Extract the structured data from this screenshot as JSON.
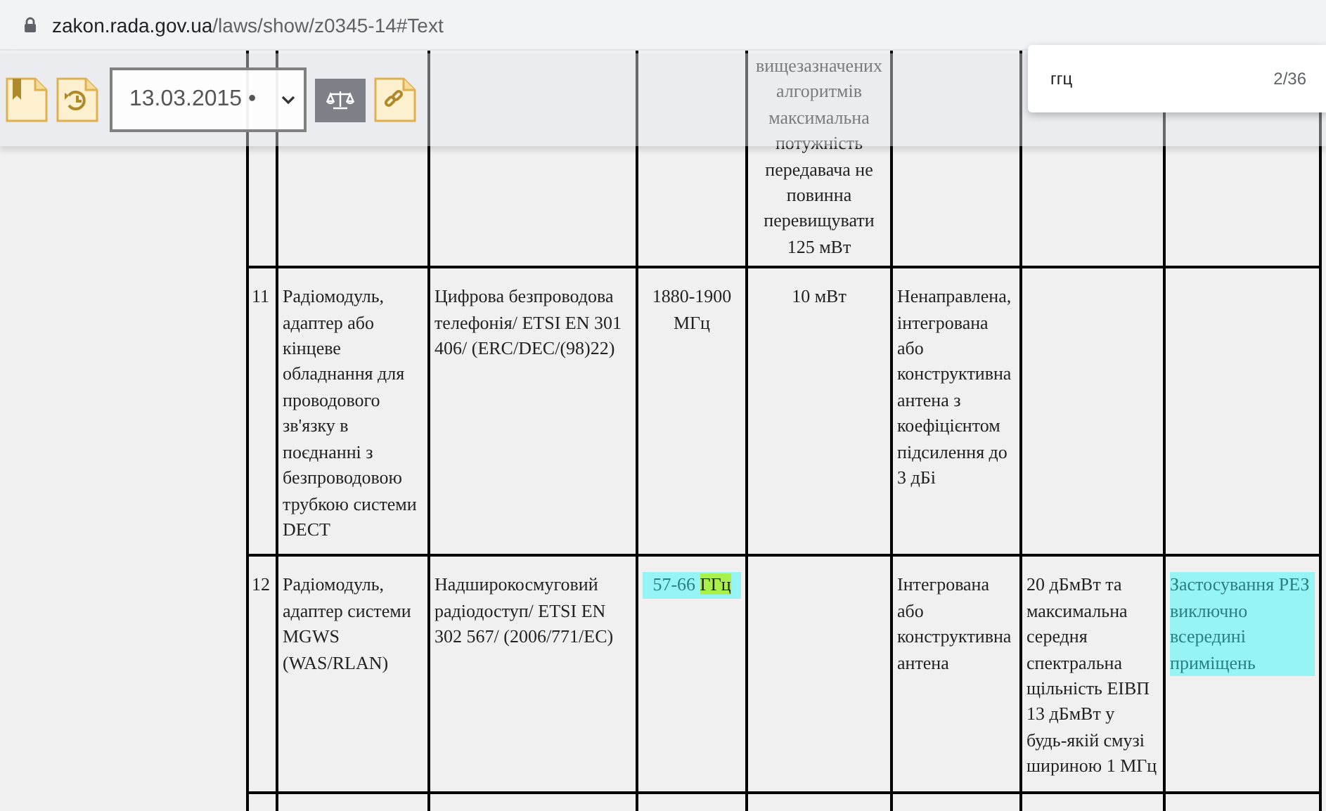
{
  "address_bar": {
    "domain": "zakon.rada.gov.ua",
    "path": "/laws/show/z0345-14#Text"
  },
  "toolbar": {
    "date_select": {
      "value": "13.03.2015 •"
    }
  },
  "find_bar": {
    "query": "ггц",
    "count": "2/36"
  },
  "table": {
    "rows": [
      {
        "number": null,
        "cells": [
          null,
          null,
          null,
          "вищезазначених алгоритмів максимальна потужність передавача не повинна перевищувати 125 мВт",
          null,
          null,
          null
        ]
      },
      {
        "number": "11",
        "cells": [
          "Радіомодуль, адаптер або кінцеве обладнання для проводового зв'язку в поєднанні з безпроводовою трубкою системи DECT",
          "Цифрова безпроводова телефонія/ ETSI EN 301 406/ (ERC/DEC/(98)22)",
          "1880-1900 МГц",
          "10 мВт",
          "Ненаправлена, інтегрована або конструктивна антена з коефіцієнтом підсилення до 3 дБі",
          null,
          null
        ]
      },
      {
        "number": "12",
        "cells": [
          "Радіомодуль, адаптер системи MGWS (WAS/RLAN)",
          "Надширокосмуговий радіодоступ/ ETSI EN 302 567/ (2006/771/EC)",
          {
            "highlighted": true,
            "parts": [
              {
                "text": "57-66 ",
                "match": false
              },
              {
                "text": "ГГц",
                "match": true
              }
            ]
          },
          null,
          "Інтегрована або конструктивна антена",
          "20 дБмВт та максимальна середня спектральна щільність ЕІВП 13 дБмВт у будь-якій смузі шириною 1 МГц",
          {
            "highlighted": true,
            "parts": [
              {
                "text": "Застосування РЕЗ виключно всередині приміщень",
                "match": false
              }
            ]
          }
        ]
      }
    ]
  }
}
